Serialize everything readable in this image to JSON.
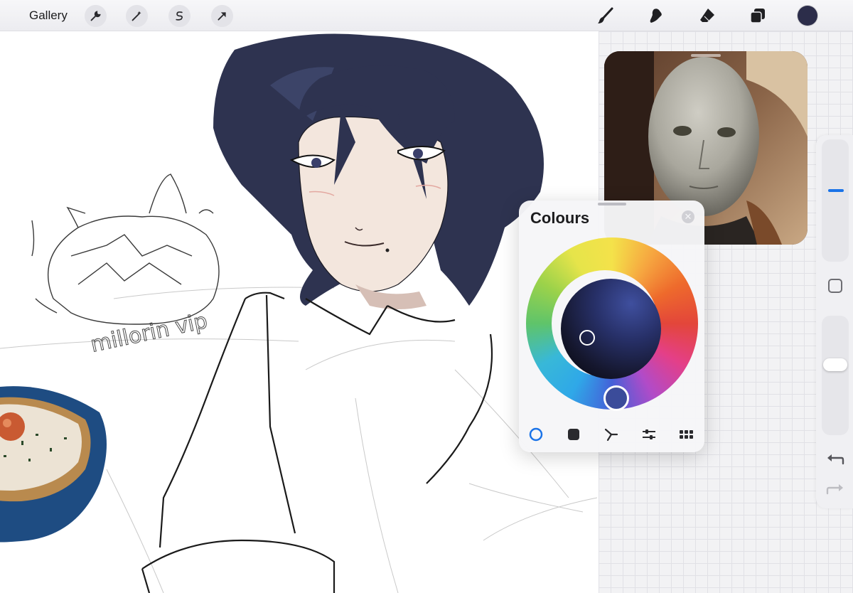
{
  "toolbar": {
    "gallery_label": "Gallery",
    "left_tools": [
      "wrench-icon",
      "magic-wand-icon",
      "selection-icon",
      "transform-arrow-icon"
    ],
    "right_tools": [
      "brush-icon",
      "smudge-icon",
      "eraser-icon",
      "layers-icon"
    ],
    "current_color": "#2c2d4a"
  },
  "colours_panel": {
    "title": "Colours",
    "close_icon": "close-icon",
    "selected_color": "#3b4c9a",
    "tabs": [
      {
        "name": "disc",
        "icon": "disc-icon",
        "active": true
      },
      {
        "name": "classic",
        "icon": "classic-square-icon",
        "active": false
      },
      {
        "name": "harmony",
        "icon": "harmony-icon",
        "active": false
      },
      {
        "name": "value",
        "icon": "sliders-icon",
        "active": false
      },
      {
        "name": "palettes",
        "icon": "palettes-grid-icon",
        "active": false
      }
    ]
  },
  "sidebar": {
    "brush_size_icon": "brush-size-slider",
    "opacity_icon": "opacity-slider",
    "modify_icon": "modify-square-icon",
    "undo_icon": "undo-icon",
    "redo_icon": "redo-icon"
  },
  "canvas": {
    "sketch_text": "millorin vip"
  },
  "colors": {
    "accent": "#1a73e8",
    "hair": "#2e3350",
    "skin": "#f3e6dd"
  }
}
